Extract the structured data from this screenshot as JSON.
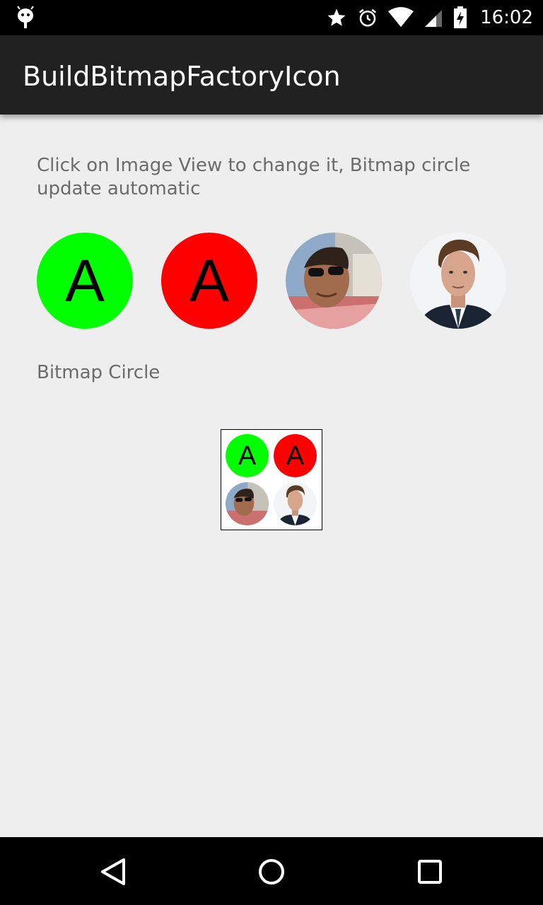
{
  "status_bar": {
    "time": "16:02",
    "icons": [
      "android-debug-icon",
      "star-icon",
      "alarm-icon",
      "wifi-icon",
      "battery-charging-icon"
    ]
  },
  "app": {
    "title": "BuildBitmapFactoryIcon"
  },
  "instructions": "Click on Image View to change it, Bitmap circle update automatic",
  "image_views": [
    {
      "type": "letter",
      "letter": "A",
      "color": "#00ff00"
    },
    {
      "type": "letter",
      "letter": "A",
      "color": "#ff0000"
    },
    {
      "type": "photo",
      "description": "man-with-sunglasses-photo"
    },
    {
      "type": "photo",
      "description": "young-man-in-suit-photo"
    }
  ],
  "bitmap_section": {
    "label": "Bitmap Circle",
    "tiles": [
      {
        "letter": "A",
        "color": "#00ff00"
      },
      {
        "letter": "A",
        "color": "#ff0000"
      }
    ]
  },
  "nav_bar": {
    "buttons": [
      "back-icon",
      "home-icon",
      "recents-icon"
    ]
  }
}
